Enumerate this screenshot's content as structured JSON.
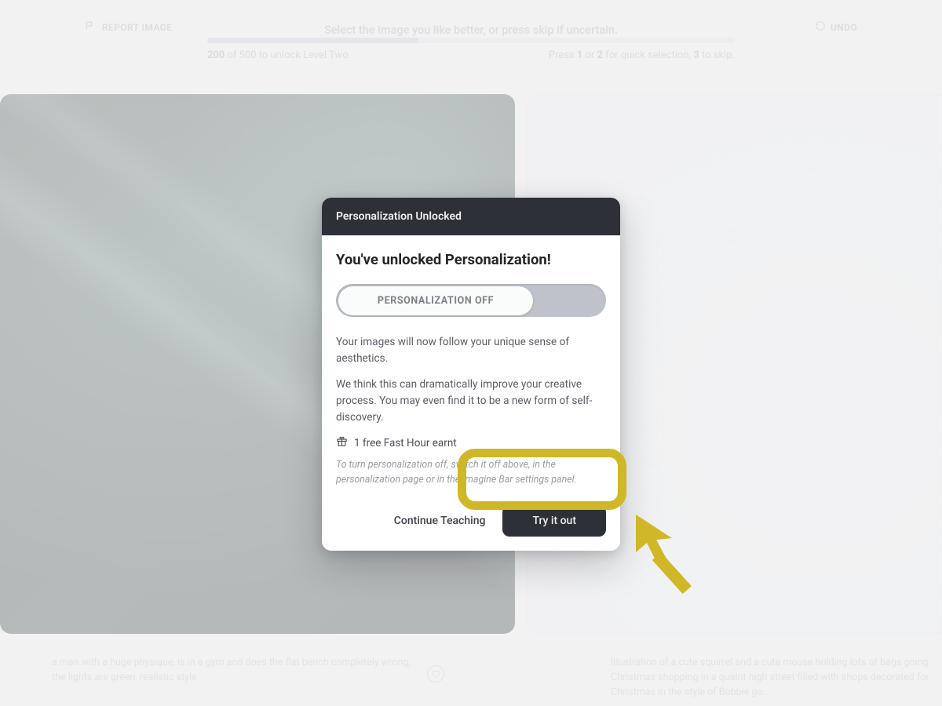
{
  "header": {
    "instruction": "Select the image you like better, or press skip if uncertain.",
    "report_label": "REPORT IMAGE",
    "undo_label": "UNDO"
  },
  "progress": {
    "current": "200",
    "goal_suffix": " of 500 to unlock Level Two",
    "keys_hint_prefix": "Press ",
    "key1": "1",
    "keys_hint_mid1": " or ",
    "key2": "2",
    "keys_hint_mid2": " for quick selection, ",
    "key3": "3",
    "keys_hint_suffix": " to skip.",
    "percent": 40
  },
  "captions": {
    "left": "a man with a huge physique, is in a gym and does the flat bench completely wrong, the lights are green, realistic style",
    "right": "Illustration of a cute squirrel and a cute mouse holding lots of bags going Christmas shopping in a quaint high street filled with shops decorated for Christmas in the style of Bobbie go…"
  },
  "modal": {
    "heading": "Personalization Unlocked",
    "title": "You've unlocked Personalization!",
    "toggle_label": "PERSONALIZATION OFF",
    "body1": "Your images will now follow your unique sense of aesthetics.",
    "body2": "We think this can dramatically improve your creative process. You may even find it to be a new form of self-discovery.",
    "reward": "1 free Fast Hour earnt",
    "fineprint": "To turn personalization off, switch it off above, in the personalization page or in the Imagine Bar settings panel.",
    "continue_label": "Continue Teaching",
    "try_label": "Try it out"
  },
  "colors": {
    "highlight": "#d0b727",
    "modal_header": "#2e3038"
  }
}
